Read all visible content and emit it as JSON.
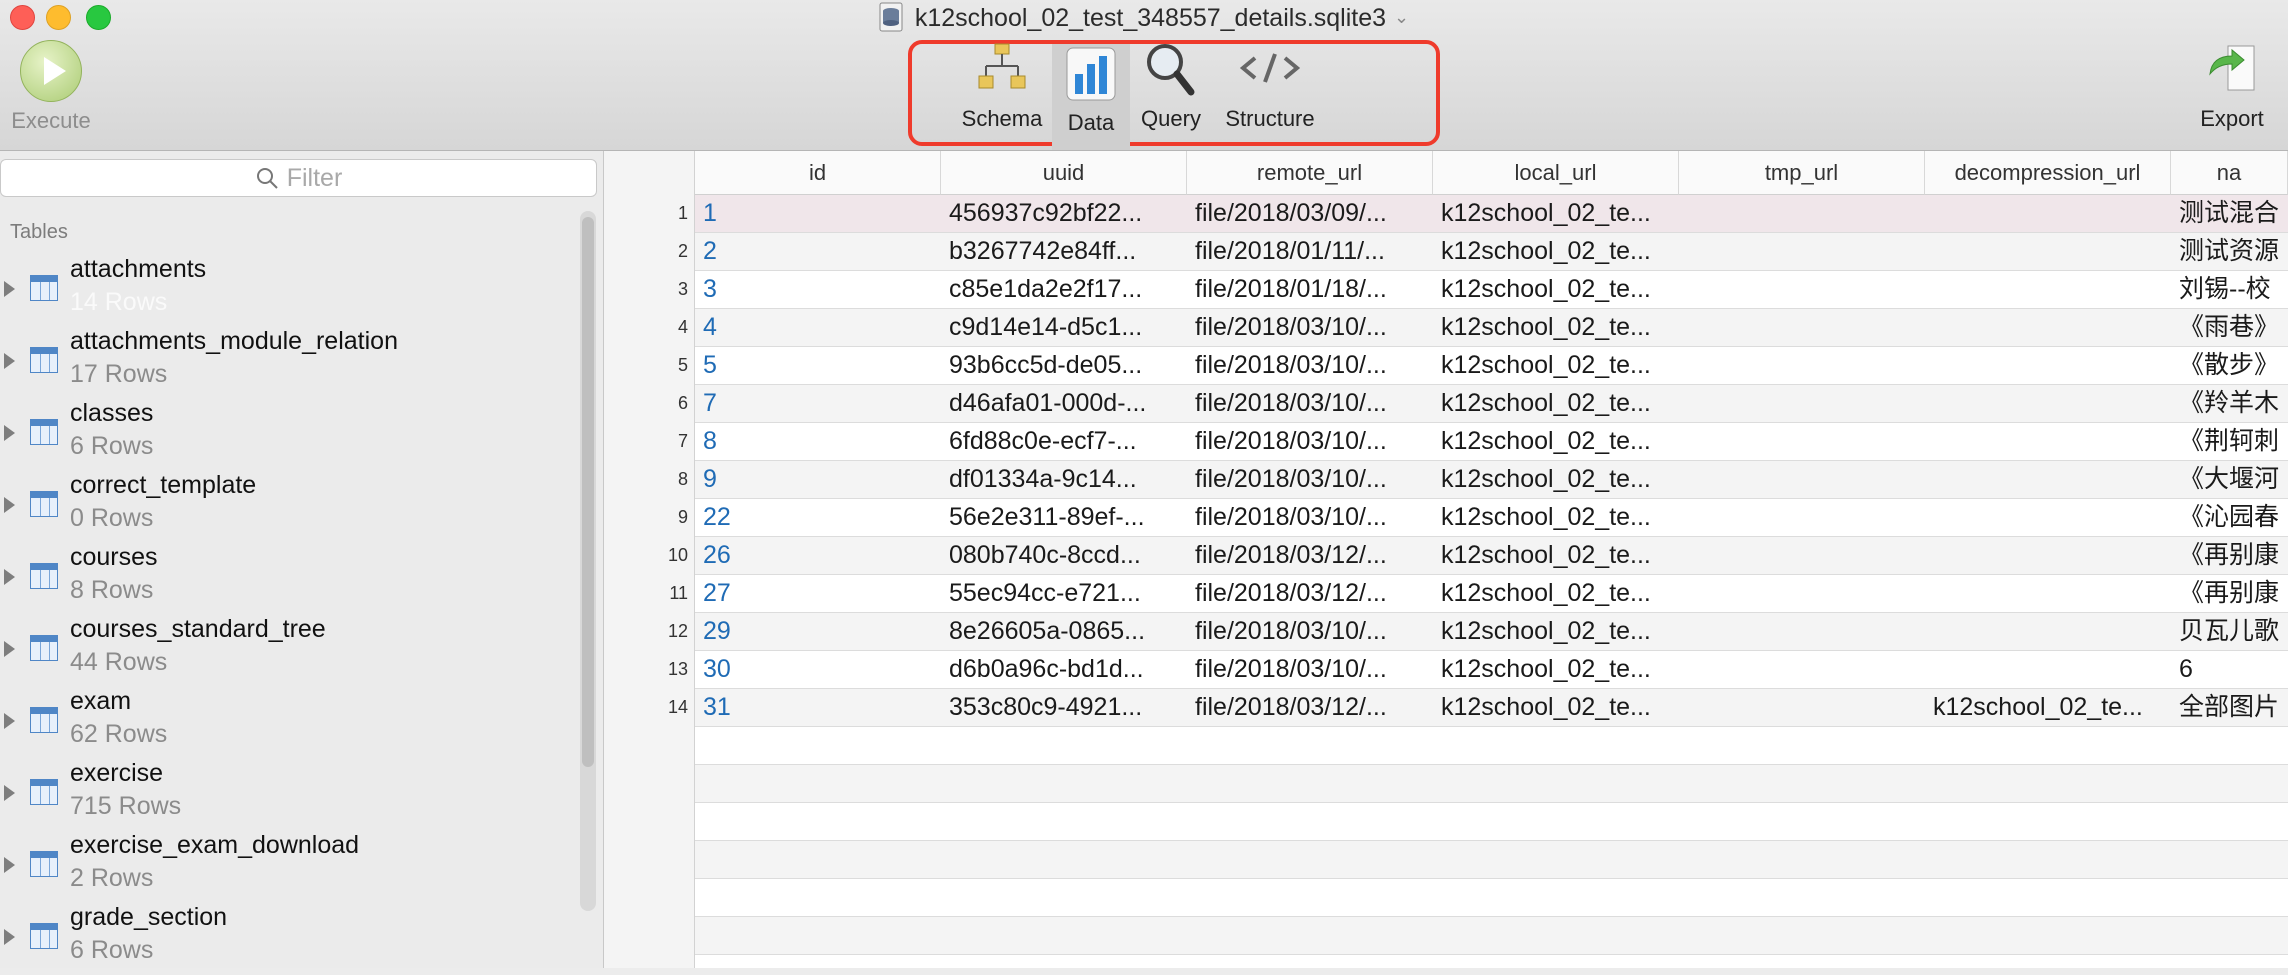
{
  "window": {
    "title": "k12school_02_test_348557_details.sqlite3"
  },
  "toolbar": {
    "execute": "Execute",
    "schema": "Schema",
    "data": "Data",
    "query": "Query",
    "structure": "Structure",
    "export": "Export"
  },
  "sidebar": {
    "filter_placeholder": "Filter",
    "tables_label": "Tables",
    "tables": [
      {
        "name": "attachments",
        "rows": "14 Rows"
      },
      {
        "name": "attachments_module_relation",
        "rows": "17 Rows"
      },
      {
        "name": "classes",
        "rows": "6 Rows"
      },
      {
        "name": "correct_template",
        "rows": "0 Rows"
      },
      {
        "name": "courses",
        "rows": "8 Rows"
      },
      {
        "name": "courses_standard_tree",
        "rows": "44 Rows"
      },
      {
        "name": "exam",
        "rows": "62 Rows"
      },
      {
        "name": "exercise",
        "rows": "715 Rows"
      },
      {
        "name": "exercise_exam_download",
        "rows": "2 Rows"
      },
      {
        "name": "grade_section",
        "rows": "6 Rows"
      }
    ]
  },
  "grid": {
    "columns": [
      "id",
      "uuid",
      "remote_url",
      "local_url",
      "tmp_url",
      "decompression_url",
      "na"
    ],
    "rows": [
      {
        "n": "1",
        "id": "1",
        "uuid": "456937c92bf22...",
        "remote_url": "file/2018/03/09/...",
        "local_url": "k12school_02_te...",
        "tmp_url": "",
        "decompression_url": "",
        "name": "测试混合"
      },
      {
        "n": "2",
        "id": "2",
        "uuid": "b3267742e84ff...",
        "remote_url": "file/2018/01/11/...",
        "local_url": "k12school_02_te...",
        "tmp_url": "",
        "decompression_url": "",
        "name": "测试资源"
      },
      {
        "n": "3",
        "id": "3",
        "uuid": "c85e1da2e2f17...",
        "remote_url": "file/2018/01/18/...",
        "local_url": "k12school_02_te...",
        "tmp_url": "",
        "decompression_url": "",
        "name": "刘锡--校"
      },
      {
        "n": "4",
        "id": "4",
        "uuid": "c9d14e14-d5c1...",
        "remote_url": "file/2018/03/10/...",
        "local_url": "k12school_02_te...",
        "tmp_url": "",
        "decompression_url": "",
        "name": "《雨巷》"
      },
      {
        "n": "5",
        "id": "5",
        "uuid": "93b6cc5d-de05...",
        "remote_url": "file/2018/03/10/...",
        "local_url": "k12school_02_te...",
        "tmp_url": "",
        "decompression_url": "",
        "name": "《散步》"
      },
      {
        "n": "6",
        "id": "7",
        "uuid": "d46afa01-000d-...",
        "remote_url": "file/2018/03/10/...",
        "local_url": "k12school_02_te...",
        "tmp_url": "",
        "decompression_url": "",
        "name": "《羚羊木"
      },
      {
        "n": "7",
        "id": "8",
        "uuid": "6fd88c0e-ecf7-...",
        "remote_url": "file/2018/03/10/...",
        "local_url": "k12school_02_te...",
        "tmp_url": "",
        "decompression_url": "",
        "name": "《荆轲刺"
      },
      {
        "n": "8",
        "id": "9",
        "uuid": "df01334a-9c14...",
        "remote_url": "file/2018/03/10/...",
        "local_url": "k12school_02_te...",
        "tmp_url": "",
        "decompression_url": "",
        "name": "《大堰河"
      },
      {
        "n": "9",
        "id": "22",
        "uuid": "56e2e311-89ef-...",
        "remote_url": "file/2018/03/10/...",
        "local_url": "k12school_02_te...",
        "tmp_url": "",
        "decompression_url": "",
        "name": "《沁园春"
      },
      {
        "n": "10",
        "id": "26",
        "uuid": "080b740c-8ccd...",
        "remote_url": "file/2018/03/12/...",
        "local_url": "k12school_02_te...",
        "tmp_url": "",
        "decompression_url": "",
        "name": "《再别康"
      },
      {
        "n": "11",
        "id": "27",
        "uuid": "55ec94cc-e721...",
        "remote_url": "file/2018/03/12/...",
        "local_url": "k12school_02_te...",
        "tmp_url": "",
        "decompression_url": "",
        "name": "《再别康"
      },
      {
        "n": "12",
        "id": "29",
        "uuid": "8e26605a-0865...",
        "remote_url": "file/2018/03/10/...",
        "local_url": "k12school_02_te...",
        "tmp_url": "",
        "decompression_url": "",
        "name": "贝瓦儿歌"
      },
      {
        "n": "13",
        "id": "30",
        "uuid": "d6b0a96c-bd1d...",
        "remote_url": "file/2018/03/10/...",
        "local_url": "k12school_02_te...",
        "tmp_url": "",
        "decompression_url": "",
        "name": "6"
      },
      {
        "n": "14",
        "id": "31",
        "uuid": "353c80c9-4921...",
        "remote_url": "file/2018/03/12/...",
        "local_url": "k12school_02_te...",
        "tmp_url": "",
        "decompression_url": "k12school_02_te...",
        "name": "全部图片"
      }
    ]
  },
  "colors": {
    "highlight_border": "#ef3b2c",
    "id_link": "#1f6bb5"
  }
}
